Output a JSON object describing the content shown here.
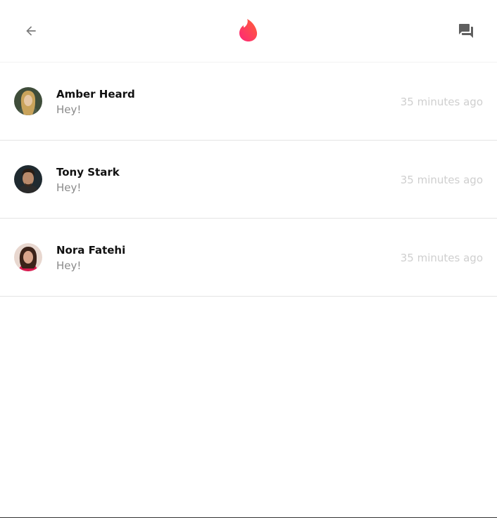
{
  "header": {
    "back_icon": "arrow-left-icon",
    "logo_icon": "flame-icon",
    "chats_icon": "forum-icon",
    "logo_colors": [
      "#fd267a",
      "#ff6036"
    ]
  },
  "conversations": [
    {
      "name": "Amber Heard",
      "message": "Hey!",
      "time": "35 minutes ago"
    },
    {
      "name": "Tony Stark",
      "message": "Hey!",
      "time": "35 minutes ago"
    },
    {
      "name": "Nora Fatehi",
      "message": "Hey!",
      "time": "35 minutes ago"
    }
  ]
}
